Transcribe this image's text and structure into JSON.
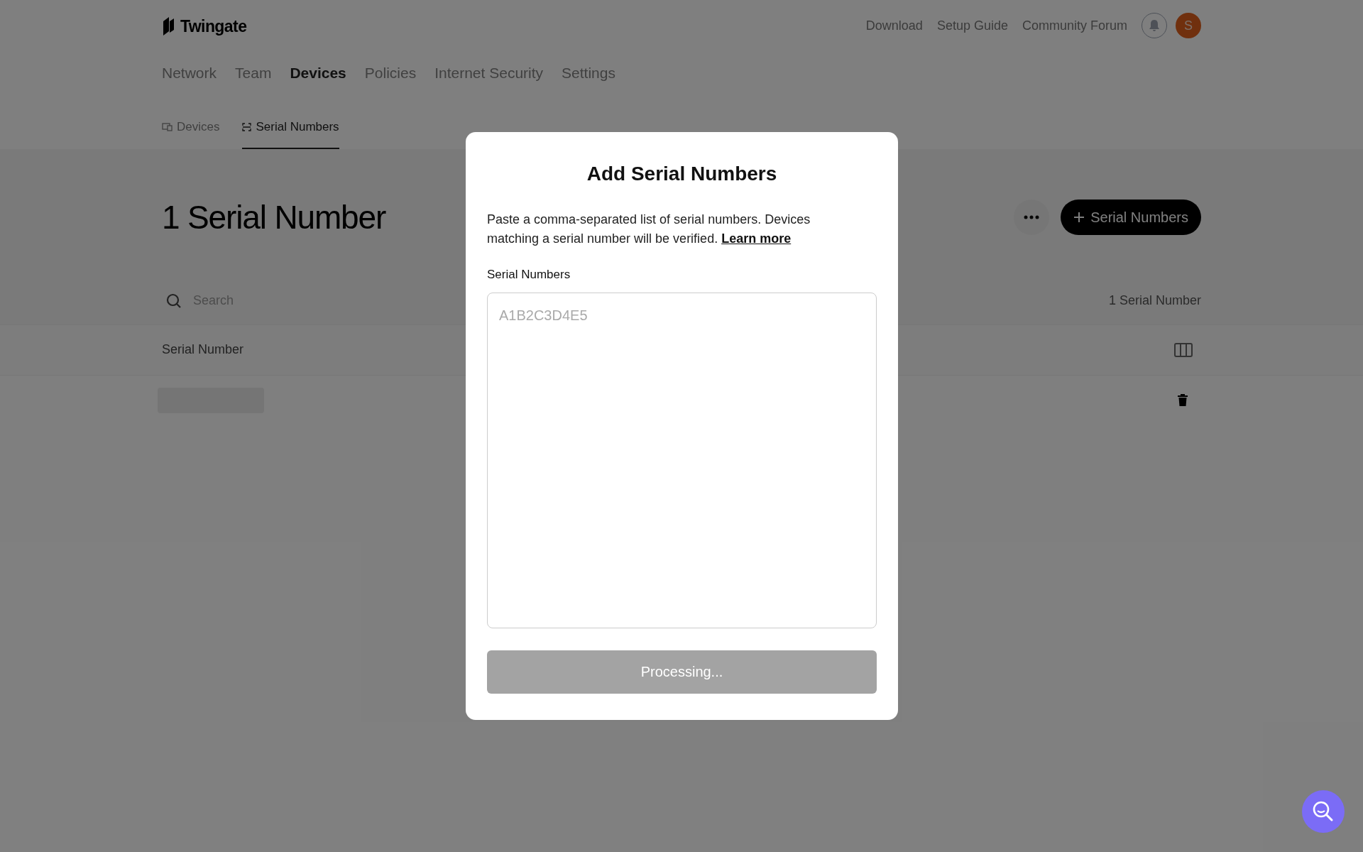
{
  "header": {
    "logo": "Twingate",
    "links": [
      "Download",
      "Setup Guide",
      "Community Forum"
    ],
    "avatar": "S"
  },
  "nav": [
    {
      "label": "Network",
      "selected": false
    },
    {
      "label": "Team",
      "selected": false
    },
    {
      "label": "Devices",
      "selected": true
    },
    {
      "label": "Policies",
      "selected": false
    },
    {
      "label": "Internet Security",
      "selected": false
    },
    {
      "label": "Settings",
      "selected": false
    }
  ],
  "subtabs": [
    {
      "label": "Devices",
      "kind": "devices",
      "selected": false
    },
    {
      "label": "Serial Numbers",
      "kind": "serials",
      "selected": true
    }
  ],
  "page": {
    "title": "1 Serial Number",
    "add_button": "Serial Numbers",
    "search": {
      "placeholder": "Search"
    },
    "count": "1 Serial Number"
  },
  "table": {
    "columns": [
      "Serial Number"
    ],
    "rows": [
      {
        "kind": "skeleton"
      }
    ]
  },
  "modal": {
    "title": "Add Serial Numbers",
    "description": "Paste a comma-separated list of serial numbers. Devices matching a serial number will be verified.",
    "link": "Learn more",
    "field_label": "Serial Numbers",
    "placeholder": "A1B2C3D4E5",
    "button": {
      "label": "Processing...",
      "disabled": true
    }
  }
}
